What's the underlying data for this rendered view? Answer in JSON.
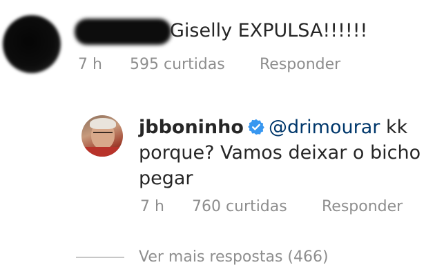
{
  "comment": {
    "text": "Giselly EXPULSA!!!!!!",
    "time": "7 h",
    "likes": "595 curtidas",
    "reply_label": "Responder"
  },
  "reply": {
    "username": "jbboninho",
    "verified_icon": "verified-badge-icon",
    "mention": "@drimourar",
    "text": " kk porque?  Vamos deixar o bicho pegar",
    "time": "7 h",
    "likes": "760 curtidas",
    "reply_label": "Responder"
  },
  "view_more": {
    "label": "Ver mais respostas (466)"
  },
  "colors": {
    "verified": "#3897f0",
    "mention": "#00376b",
    "meta": "#8e8e8e",
    "text": "#262626"
  }
}
